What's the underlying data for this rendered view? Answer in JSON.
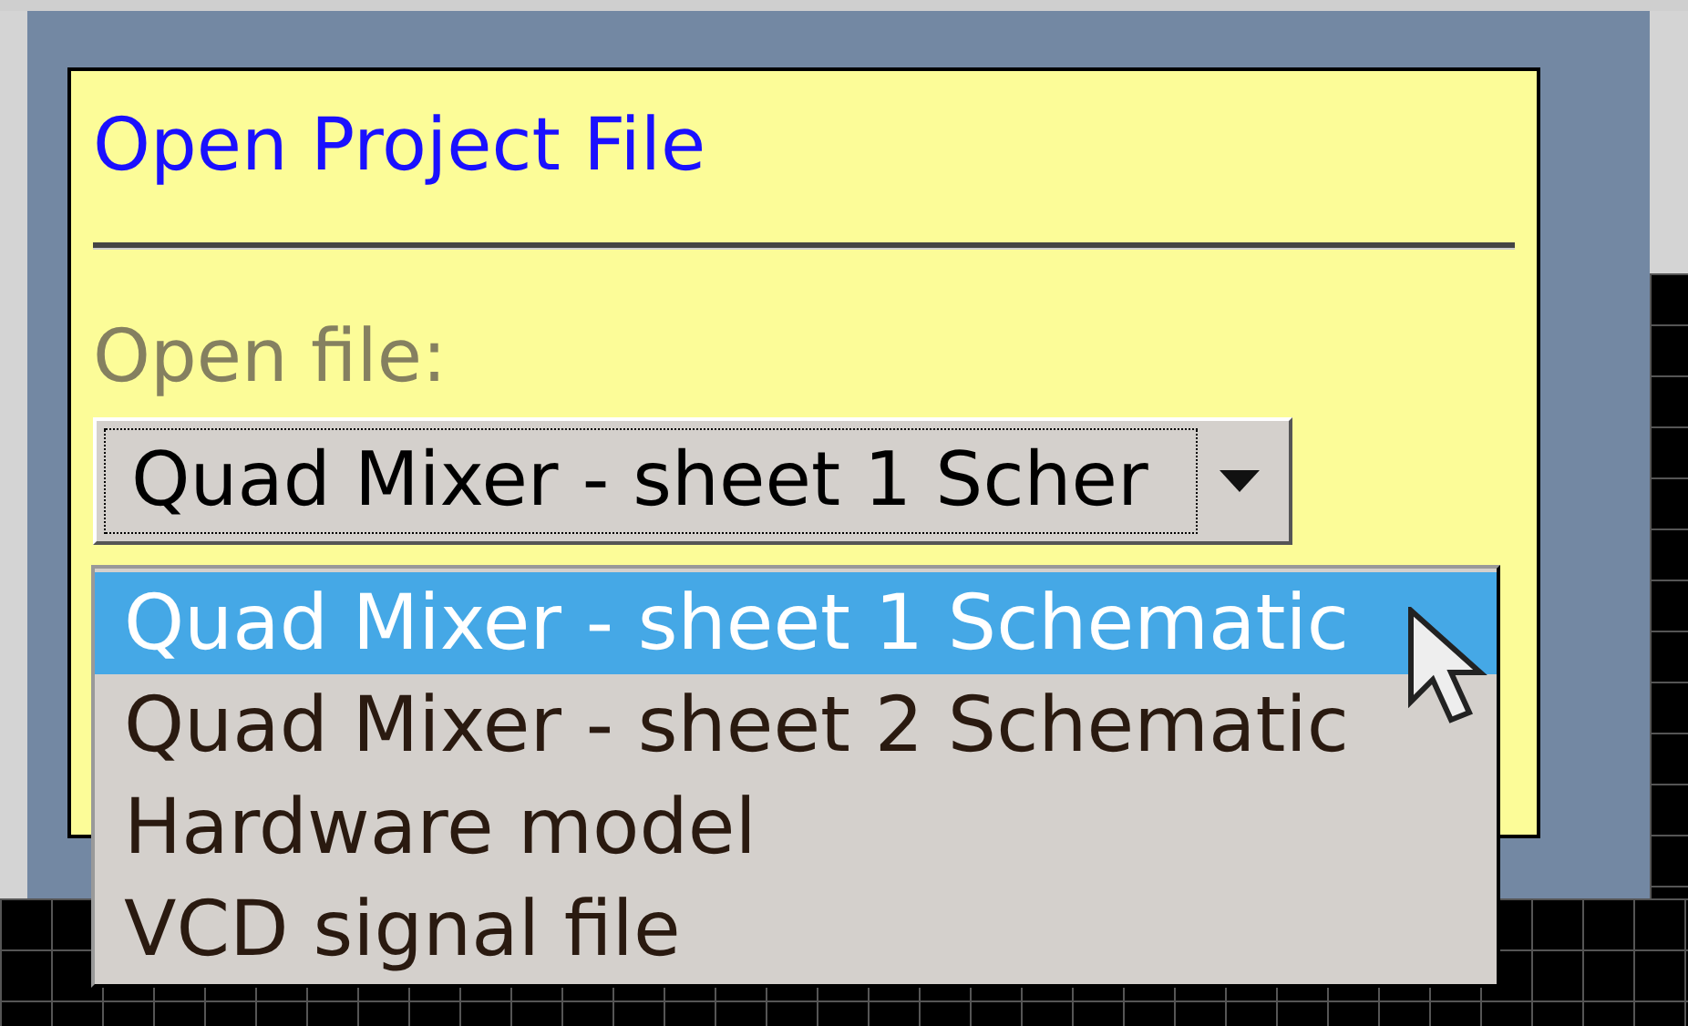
{
  "dialog": {
    "title": "Open Project File",
    "label": "Open file:",
    "select": {
      "value": "Quad Mixer - sheet 1 Scher",
      "expanded": true
    },
    "options": [
      {
        "label": "Quad Mixer - sheet 1 Schematic",
        "selected": true
      },
      {
        "label": "Quad Mixer - sheet 2 Schematic",
        "selected": false
      },
      {
        "label": "Hardware model",
        "selected": false
      },
      {
        "label": "VCD signal file",
        "selected": false
      }
    ]
  }
}
